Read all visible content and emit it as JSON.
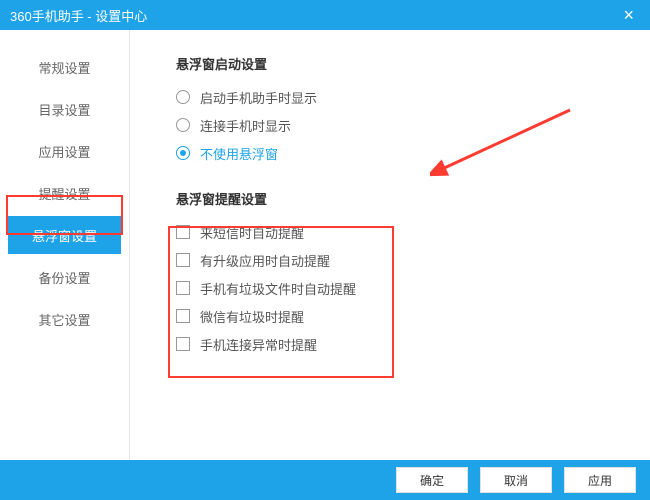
{
  "header": {
    "title": "360手机助手 - 设置中心"
  },
  "sidebar": {
    "items": [
      {
        "label": "常规设置"
      },
      {
        "label": "目录设置"
      },
      {
        "label": "应用设置"
      },
      {
        "label": "提醒设置"
      },
      {
        "label": "悬浮窗设置"
      },
      {
        "label": "备份设置"
      },
      {
        "label": "其它设置"
      }
    ]
  },
  "content": {
    "section1_title": "悬浮窗启动设置",
    "radios": [
      {
        "label": "启动手机助手时显示"
      },
      {
        "label": "连接手机时显示"
      },
      {
        "label": "不使用悬浮窗"
      }
    ],
    "section2_title": "悬浮窗提醒设置",
    "checks": [
      {
        "label": "来短信时自动提醒"
      },
      {
        "label": "有升级应用时自动提醒"
      },
      {
        "label": "手机有垃圾文件时自动提醒"
      },
      {
        "label": "微信有垃圾时提醒"
      },
      {
        "label": "手机连接异常时提醒"
      }
    ]
  },
  "footer": {
    "ok": "确定",
    "cancel": "取消",
    "apply": "应用"
  },
  "colors": {
    "accent": "#1ea3e8",
    "highlight": "#ff3a30"
  }
}
